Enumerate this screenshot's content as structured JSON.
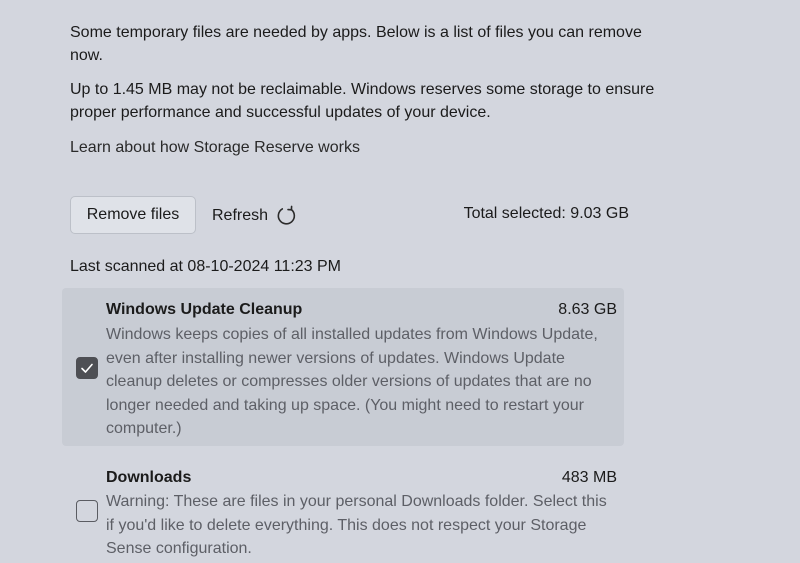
{
  "intro": {
    "paragraph1": "Some temporary files are needed by apps. Below is a list of files you can remove now.",
    "paragraph2": "Up to 1.45 MB may not be reclaimable. Windows reserves some storage to ensure proper performance and successful updates of your device.",
    "learn_link": "Learn about how Storage Reserve works"
  },
  "toolbar": {
    "remove_label": "Remove files",
    "refresh_label": "Refresh",
    "total_selected": "Total selected: 9.03 GB"
  },
  "last_scanned": "Last scanned at 08-10-2024 11:23 PM",
  "items": [
    {
      "title": "Windows Update Cleanup",
      "size": "8.63 GB",
      "description": "Windows keeps copies of all installed updates from Windows Update, even after installing newer versions of updates. Windows Update cleanup deletes or compresses older versions of updates that are no longer needed and taking up space. (You might need to restart your computer.)",
      "checked": true
    },
    {
      "title": "Downloads",
      "size": "483 MB",
      "description": "Warning: These are files in your personal Downloads folder. Select this if you'd like to delete everything. This does not respect your Storage Sense configuration.",
      "checked": false
    }
  ],
  "icons": {
    "refresh": "refresh-icon",
    "checkmark": "checkmark-icon"
  },
  "colors": {
    "background": "#d3d6de",
    "selected_row": "#c8ccd4",
    "checkbox_checked": "#4e4f54",
    "description_text": "#5d5f66"
  }
}
